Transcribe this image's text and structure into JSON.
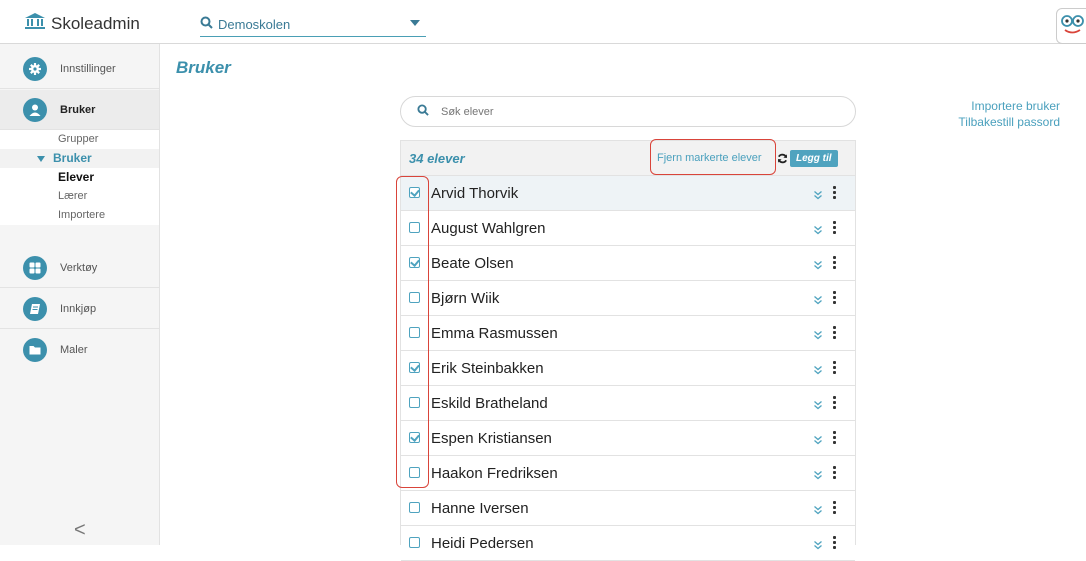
{
  "app": {
    "brand": "Skoleadmin",
    "school": "Demoskolen",
    "brand_color": "#3c90ac",
    "annotation_color": "#d9443a"
  },
  "sidebar": {
    "items": [
      {
        "label": "Innstillinger",
        "icon": "gear-icon"
      },
      {
        "label": "Bruker",
        "icon": "user-icon"
      },
      {
        "label": "Verktøy",
        "icon": "grid-icon"
      },
      {
        "label": "Innkjøp",
        "icon": "book-icon"
      },
      {
        "label": "Maler",
        "icon": "folder-icon"
      }
    ],
    "subnav": {
      "grupper": "Grupper",
      "bruker": "Bruker",
      "elever": "Elever",
      "laerer": "Lærer",
      "importere": "Importere"
    },
    "collapse": "<"
  },
  "main": {
    "title": "Bruker",
    "search_placeholder": "Søk elever",
    "links": {
      "import": "Importere bruker",
      "reset": "Tilbakestill passord"
    },
    "list": {
      "count": "34 elever",
      "remove_label": "Fjern markerte elever",
      "add_label": "Legg til",
      "rows": [
        {
          "name": "Arvid Thorvik",
          "checked": true
        },
        {
          "name": "August Wahlgren",
          "checked": false
        },
        {
          "name": "Beate Olsen",
          "checked": true
        },
        {
          "name": "Bjørn Wiik",
          "checked": false
        },
        {
          "name": "Emma Rasmussen",
          "checked": false
        },
        {
          "name": "Erik Steinbakken",
          "checked": true
        },
        {
          "name": "Eskild Bratheland",
          "checked": false
        },
        {
          "name": "Espen Kristiansen",
          "checked": true
        },
        {
          "name": "Haakon Fredriksen",
          "checked": false
        },
        {
          "name": "Hanne Iversen",
          "checked": false
        },
        {
          "name": "Heidi Pedersen",
          "checked": false
        }
      ]
    }
  }
}
